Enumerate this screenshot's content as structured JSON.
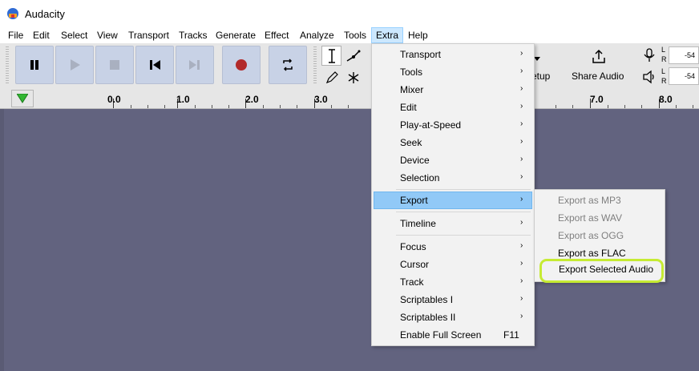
{
  "window": {
    "title": "Audacity"
  },
  "menubar": [
    "File",
    "Edit",
    "Select",
    "View",
    "Transport",
    "Tracks",
    "Generate",
    "Effect",
    "Analyze",
    "Tools",
    "Extra",
    "Help"
  ],
  "toolbar": {
    "setup_label": "etup",
    "share_label": "Share Audio"
  },
  "meters": {
    "record_value": "-54",
    "play_value": "-54",
    "left": "L",
    "right": "R"
  },
  "ruler": {
    "ticks": [
      "0.0",
      "1.0",
      "2.0",
      "3.0",
      "7.0",
      "8.0"
    ]
  },
  "extra_menu": {
    "items": [
      {
        "label": "Transport",
        "submenu": true
      },
      {
        "label": "Tools",
        "submenu": true
      },
      {
        "label": "Mixer",
        "submenu": true
      },
      {
        "label": "Edit",
        "submenu": true
      },
      {
        "label": "Play-at-Speed",
        "submenu": true
      },
      {
        "label": "Seek",
        "submenu": true
      },
      {
        "label": "Device",
        "submenu": true
      },
      {
        "label": "Selection",
        "submenu": true
      },
      {
        "label": "Export",
        "submenu": true,
        "highlighted": true
      },
      {
        "label": "Timeline",
        "submenu": true
      },
      {
        "label": "Focus",
        "submenu": true
      },
      {
        "label": "Cursor",
        "submenu": true
      },
      {
        "label": "Track",
        "submenu": true
      },
      {
        "label": "Scriptables I",
        "submenu": true
      },
      {
        "label": "Scriptables II",
        "submenu": true
      },
      {
        "label": "Enable Full Screen",
        "shortcut": "F11"
      }
    ],
    "arrow": "›"
  },
  "export_submenu": {
    "items": [
      {
        "label": "Export as MP3",
        "enabled": false
      },
      {
        "label": "Export as WAV",
        "enabled": false
      },
      {
        "label": "Export as OGG",
        "enabled": false
      },
      {
        "label": "Export as FLAC",
        "enabled": true
      },
      {
        "label": "Export Selected Audio",
        "enabled": true,
        "callout": true
      }
    ]
  },
  "colors": {
    "accent_highlight": "#91c9f7",
    "callout": "#c6eb33",
    "workspace": "#62637f",
    "record": "#b22a2a"
  }
}
